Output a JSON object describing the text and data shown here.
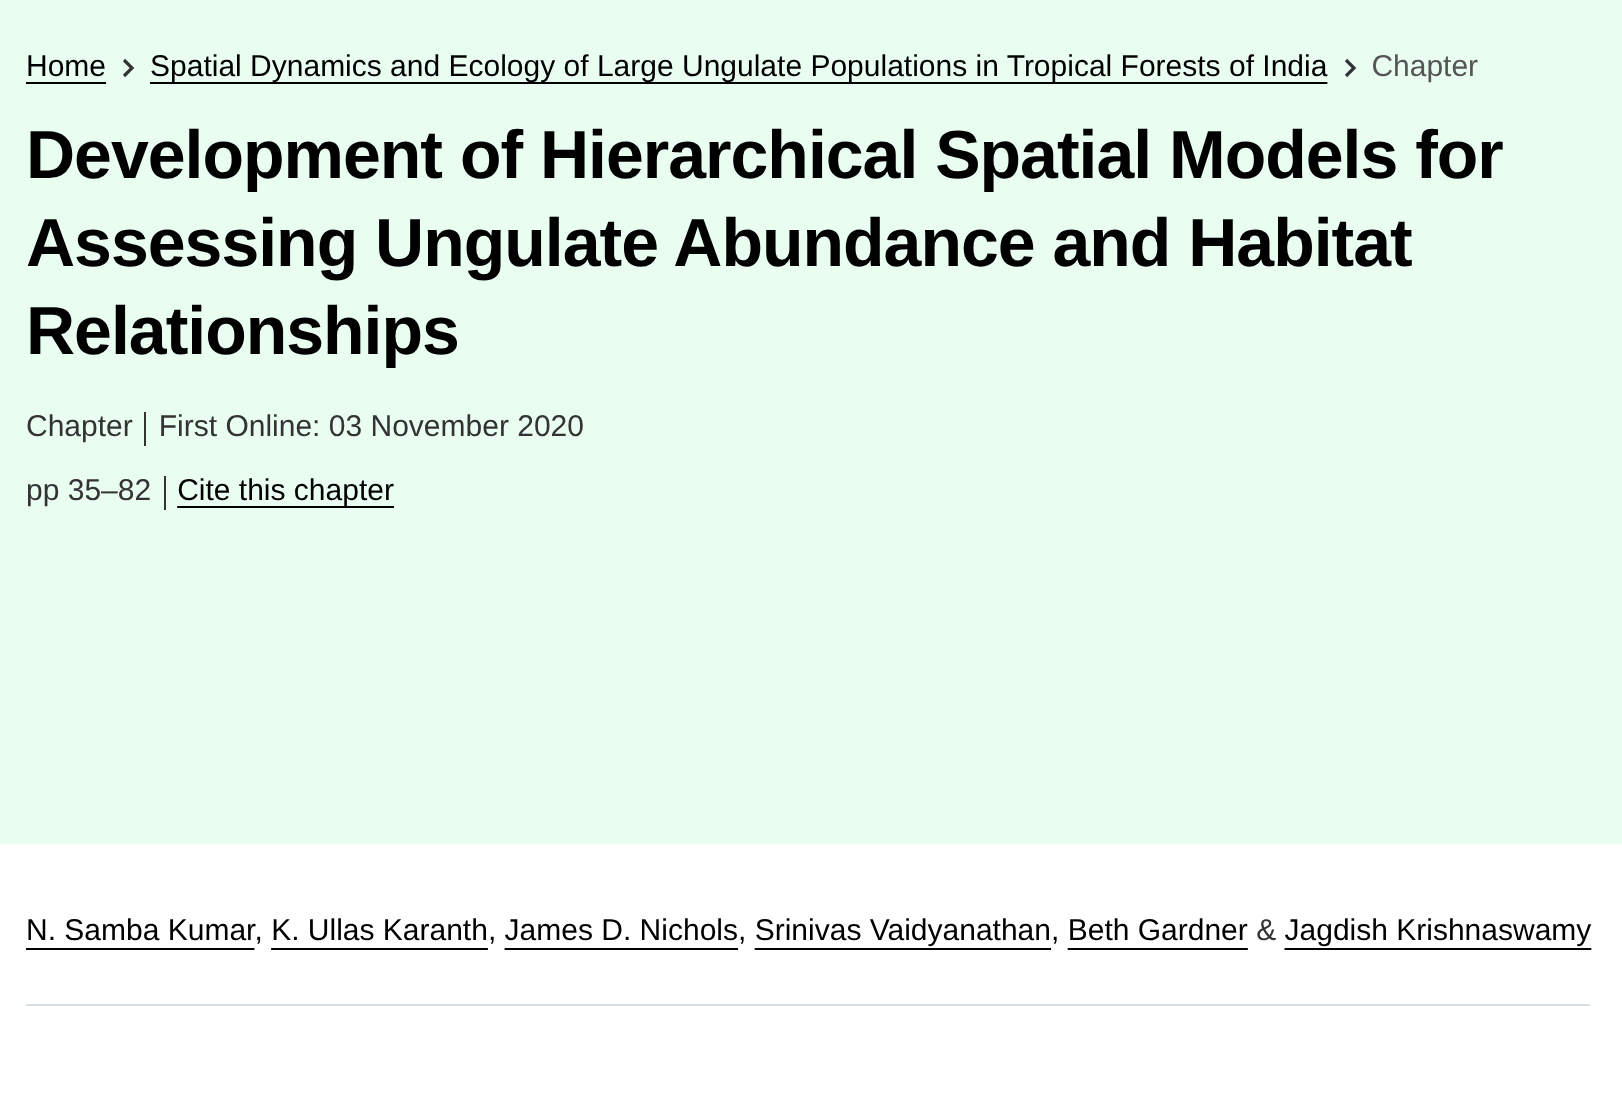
{
  "breadcrumbs": [
    {
      "label": "Home",
      "kind": "link"
    },
    {
      "label": "Spatial Dynamics and Ecology of Large Ungulate Populations in Tropical Forests of India",
      "kind": "link"
    },
    {
      "label": "Chapter",
      "kind": "current"
    }
  ],
  "title": "Development of Hierarchical Spatial Models for Assessing Ungulate Abundance and Habitat Relationships",
  "meta_lines": [
    [
      {
        "text": "Chapter",
        "kind": "text"
      },
      {
        "text": "First Online: 03 November 2020",
        "kind": "text"
      }
    ],
    [
      {
        "text": "pp 35–82",
        "kind": "text"
      },
      {
        "text": "Cite this chapter",
        "kind": "link"
      }
    ]
  ],
  "authors": [
    {
      "name": "N. Samba Kumar",
      "separator": ","
    },
    {
      "name": "K. Ullas Karanth",
      "separator": ","
    },
    {
      "name": "James D. Nichols",
      "separator": ","
    },
    {
      "name": "Srinivas Vaidyanathan",
      "separator": ","
    },
    {
      "name": "Beth Gardner",
      "separator": "&"
    },
    {
      "name": "Jagdish Krishnaswamy"
    }
  ]
}
